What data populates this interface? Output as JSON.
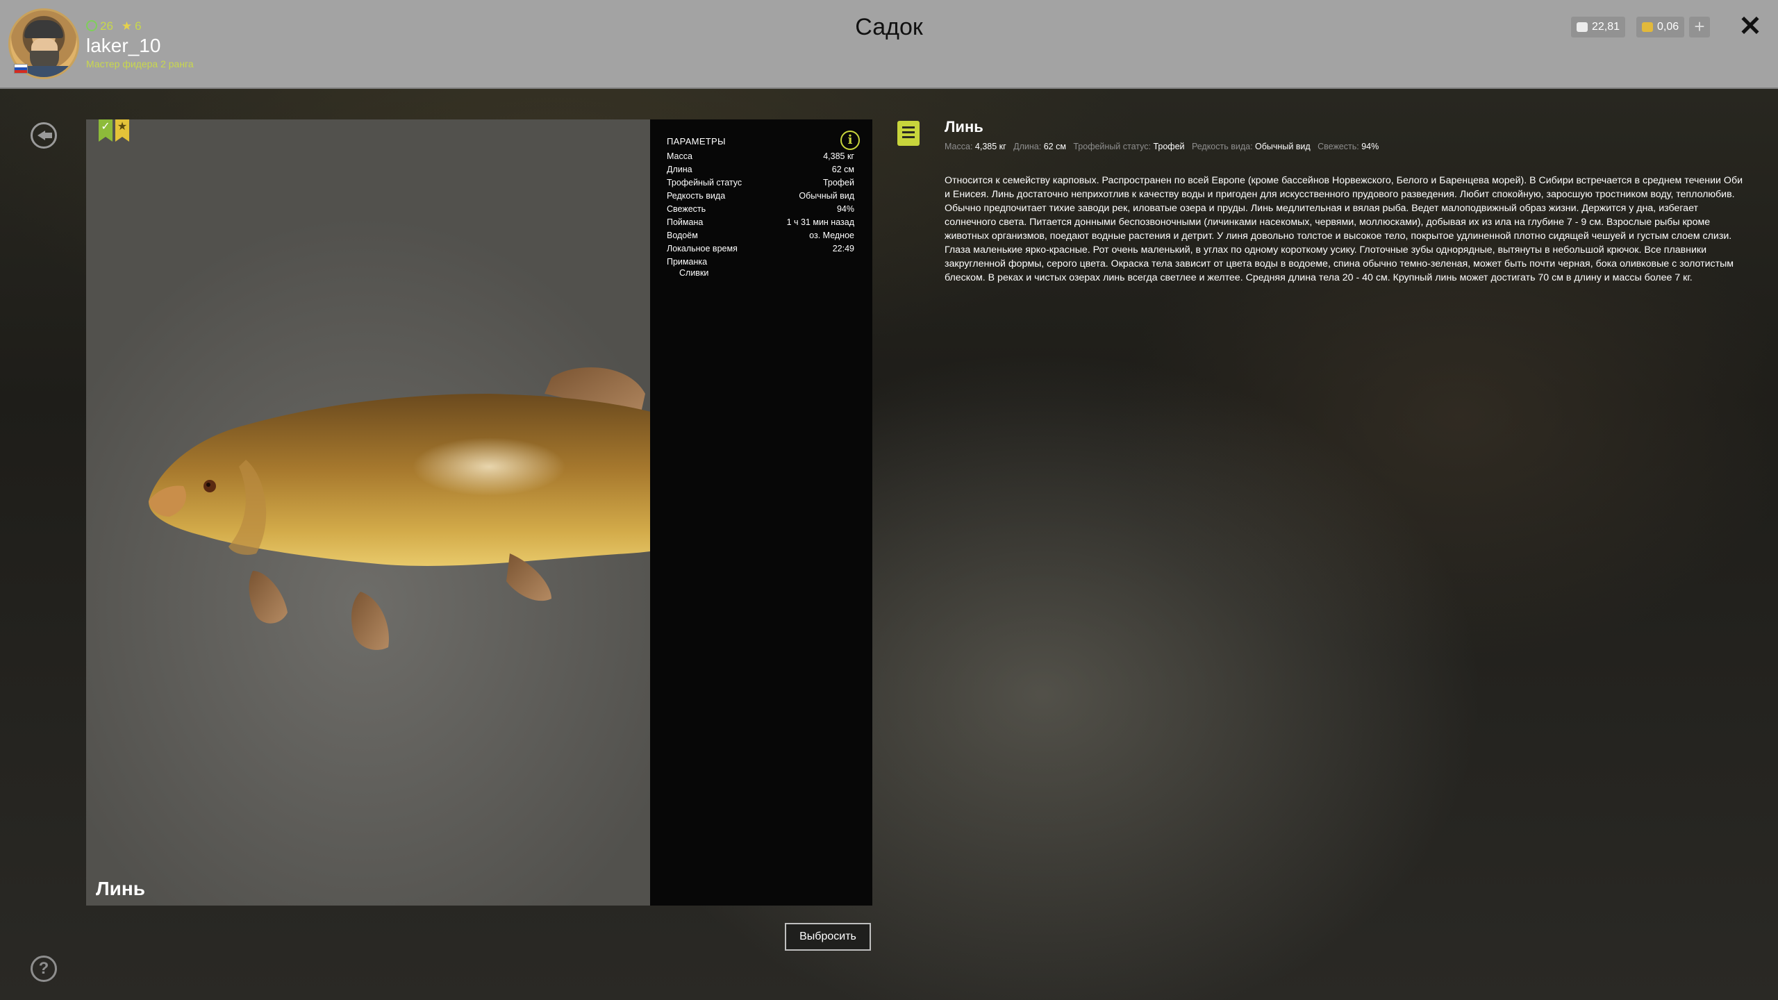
{
  "header": {
    "title": "Садок",
    "player": {
      "level": "26",
      "stars": "6",
      "username": "laker_10",
      "rank": "Мастер фидера 2 ранга"
    },
    "currency": {
      "silver": "22,81",
      "gold": "0,06"
    },
    "add_label": "+",
    "close_label": "✕"
  },
  "viewer": {
    "fish_name": "Линь",
    "badges": [
      "✓",
      "★"
    ]
  },
  "params": {
    "heading": "ПАРАМЕТРЫ",
    "rows": [
      {
        "label": "Масса",
        "value": "4,385 кг"
      },
      {
        "label": "Длина",
        "value": "62 см"
      },
      {
        "label": "Трофейный статус",
        "value": "Трофей"
      },
      {
        "label": "Редкость вида",
        "value": "Обычный вид"
      },
      {
        "label": "Свежесть",
        "value": "94%"
      },
      {
        "label": "Поймана",
        "value": "1 ч 31 мин назад"
      },
      {
        "label": "Водоём",
        "value": "оз. Медное"
      },
      {
        "label": "Локальное время",
        "value": "22:49"
      }
    ],
    "lure_label": "Приманка",
    "lure_value": "Сливки"
  },
  "description": {
    "title": "Линь",
    "meta": {
      "mass_label": "Масса:",
      "mass": "4,385 кг",
      "length_label": "Длина:",
      "length": "62 см",
      "trophy_label": "Трофейный статус:",
      "trophy": "Трофей",
      "rarity_label": "Редкость вида:",
      "rarity": "Обычный вид",
      "fresh_label": "Свежесть:",
      "fresh": "94%"
    },
    "text": "Относится к семейству карповых. Распространен по всей Европе (кроме бассейнов Норвежского, Белого и Баренцева морей). В Сибири встречается в среднем течении Оби и Енисея. Линь достаточно неприхотлив к качеству воды и пригоден для искусственного прудового разведения. Любит спокойную, заросшую тростником воду, теплолюбив. Обычно предпочитает тихие заводи рек, иловатые озера и пруды. Линь медлительная и вялая рыба. Ведет малоподвижный образ жизни. Держится у дна, избегает солнечного света. Питается донными беспозвоночными (личинками насекомых, червями, моллюсками), добывая их из ила на глубине 7 - 9 см. Взрослые рыбы кроме животных организмов, поедают водные растения и детрит. У линя довольно толстое и высокое тело, покрытое удлиненной плотно сидящей чешуей и густым слоем слизи. Глаза маленькие ярко-красные. Рот очень маленький, в углах по одному короткому усику. Глоточные зубы однорядные, вытянуты в небольшой крючок. Все плавники закругленной формы, серого цвета. Окраска тела зависит от цвета воды в водоеме, спина обычно темно-зеленая, может быть почти черная, бока оливковые с золотистым блеском. В реках и чистых озерах линь всегда светлее и желтее. Средняя длина тела 20 - 40 см. Крупный линь может достигать 70 см в длину и массы более 7 кг."
  },
  "actions": {
    "release_label": "Выбросить",
    "help_label": "?"
  },
  "colors": {
    "accent": "#c8d53c",
    "topbar": "#a3a3a3",
    "panel": "#070707"
  },
  "icons": [
    "back-arrow-icon",
    "help-icon",
    "info-icon",
    "notes-icon",
    "close-icon",
    "silver-coin-icon",
    "gold-coin-icon",
    "plus-icon"
  ]
}
